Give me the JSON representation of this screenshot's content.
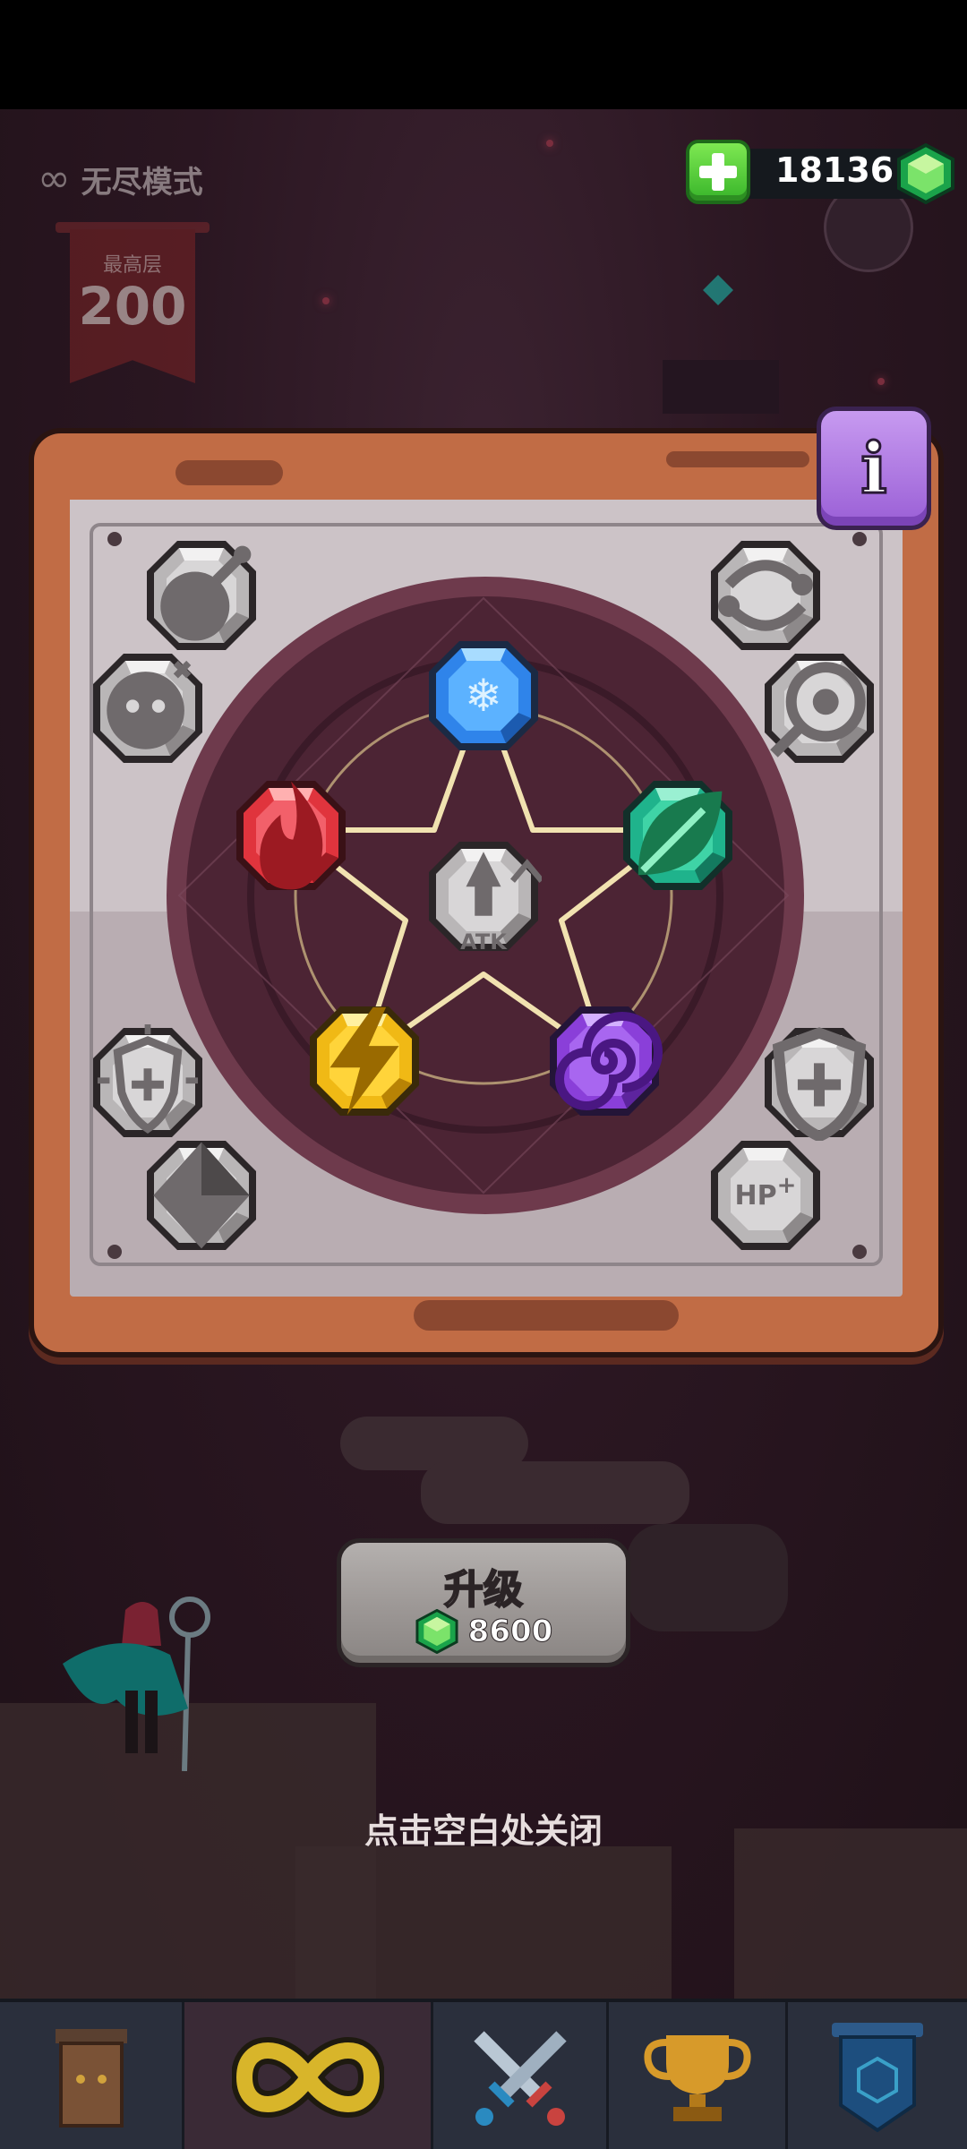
{
  "header": {
    "mode_label": "无尽模式",
    "best_floor_label": "最高层",
    "best_floor_value": "200"
  },
  "currency": {
    "amount": "18136",
    "icons": {
      "add": "plus-icon",
      "gem": "green-gem-icon"
    }
  },
  "panel": {
    "info_button": "i",
    "center_gem_label": "ATK",
    "pentagram_gems": [
      {
        "name": "ice",
        "icon": "snowflake-icon",
        "color": "#2f84ea"
      },
      {
        "name": "nature",
        "icon": "leaf-icon",
        "color": "#1fb38c"
      },
      {
        "name": "arcane",
        "icon": "spiral-icon",
        "color": "#8a3fd9"
      },
      {
        "name": "lightning",
        "icon": "lightning-icon",
        "color": "#f0b915"
      },
      {
        "name": "fire",
        "icon": "flame-icon",
        "color": "#e0343d"
      }
    ],
    "side_gems_left": [
      "bomb-icon",
      "ghost-icon",
      "shield-burst-icon",
      "diamond-icon"
    ],
    "side_gems_right": [
      "swirl-arrows-icon",
      "target-icon",
      "shield-plus-icon",
      "hp-plus-icon"
    ],
    "side_gem_hp_label": "HP"
  },
  "upgrade": {
    "label": "升级",
    "cost": "8600"
  },
  "close_hint": "点击空白处关闭",
  "nav": {
    "items": [
      "treasure-chest-icon",
      "infinity-icon",
      "crossed-swords-icon",
      "trophy-icon",
      "badge-icon"
    ]
  },
  "colors": {
    "panel_frame": "#c16c45",
    "plate": "#c5bcc0",
    "circle": "#4c2434",
    "pentagram_line": "#f1e2b0",
    "button_gray": "#9c9795",
    "gem_green": "#2fc85a"
  }
}
